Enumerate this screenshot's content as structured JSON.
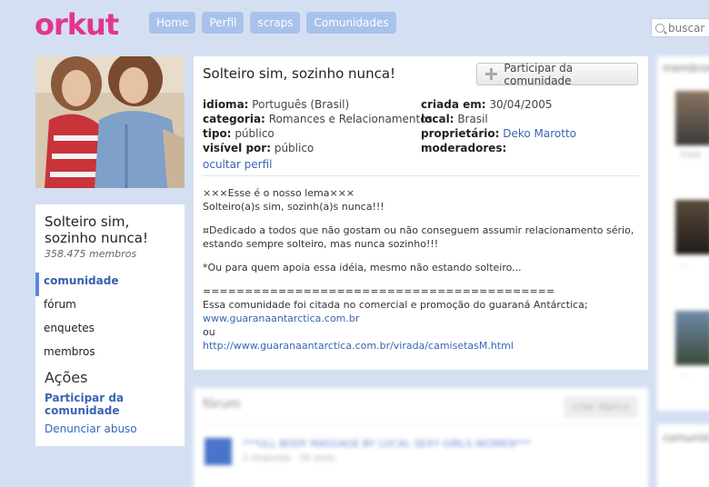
{
  "logo": "orkut",
  "nav": {
    "home": "Home",
    "profile": "Perfil",
    "scraps": "scraps",
    "communities": "Comunidades"
  },
  "search": {
    "placeholder": "buscar"
  },
  "community": {
    "name": "Solteiro sim, sozinho nunca!",
    "members_count": "358.475 membros",
    "join_button": "Participar da comunidade",
    "info": {
      "idioma_label": "idioma:",
      "idioma": "Português (Brasil)",
      "categoria_label": "categoria:",
      "categoria": "Romances e Relacionamentos",
      "tipo_label": "tipo:",
      "tipo": "público",
      "visivel_label": "visível por:",
      "visivel": "público",
      "criada_label": "criada em:",
      "criada": "30/04/2005",
      "local_label": "local:",
      "local": "Brasil",
      "proprietario_label": "proprietário:",
      "proprietario": "Deko Marotto",
      "moderadores_label": "moderadores:"
    },
    "hide_profile": "ocultar perfil",
    "description": {
      "l1": "×××Esse é o nosso lema×××",
      "l2": "Solteiro(a)s sim, sozinh(a)s nunca!!!",
      "l3": "¤Dedicado a todos que não gostam ou não conseguem assumir relacionamento sério,",
      "l4": "estando sempre solteiro, mas nunca sozinho!!!",
      "l5": "*Ou para quem apoia essa idéia, mesmo não estando solteiro...",
      "l6": "==========================================",
      "l7": "Essa comunidade foi citada no comercial e promoção do guaraná Antárctica;",
      "link1": "www.guaranaantarctica.com.br",
      "l8": "ou",
      "link2": "http://www.guaranaantarctica.com.br/virada/camisetasM.html"
    }
  },
  "sidebar": {
    "menu": [
      "comunidade",
      "fórum",
      "enquetes",
      "membros"
    ],
    "actions_title": "Ações",
    "join_link": "Participar da comunidade",
    "report_link": "Denunciar abuso"
  },
  "forum": {
    "title": "fórum",
    "new_topic": "criar tópico",
    "topic": "***ULL BODY MASSAGE BY LOCAL SEXY GIRLS WOMEN***",
    "meta": "1 resposta · 34 anos"
  },
  "right": {
    "members_title": "membros",
    "communities_title": "comunid"
  },
  "colors": {
    "logo": "#e3358f",
    "nav": "#a9c2ec",
    "background": "#d4e0f2",
    "link": "#3a64b3"
  }
}
